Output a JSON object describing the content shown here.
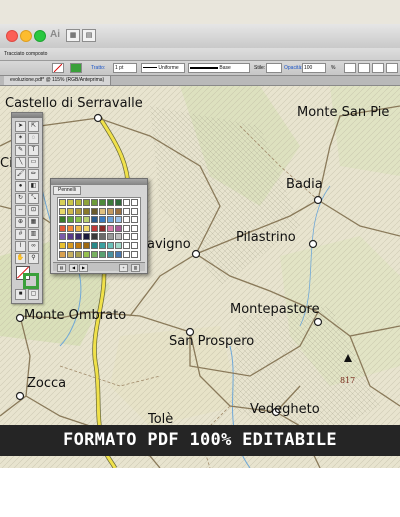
{
  "app": {
    "logo": "Ai"
  },
  "toolbar": {
    "tool_label": "Tracciato composto",
    "stroke_label": "Tratto:",
    "stroke_weight": "1 pt",
    "profile_label": "Uniforme",
    "brush_label": "Base",
    "style_label": "Stile:",
    "opacity_label": "Opacità:",
    "opacity_value": "100",
    "opacity_unit": "%"
  },
  "document": {
    "tab_label": "evoluzione.pdf* @ 115% (RGB/Anteprima)"
  },
  "map": {
    "places": [
      {
        "name": "Castello di Serravalle"
      },
      {
        "name": "Monte San Pie"
      },
      {
        "name": "Badia"
      },
      {
        "name": "Pilastrino"
      },
      {
        "name": "avigno"
      },
      {
        "name": "Montepastore"
      },
      {
        "name": "Monte Ombrato"
      },
      {
        "name": "San Prospero"
      },
      {
        "name": "Zocca"
      },
      {
        "name": "Vedegheto"
      },
      {
        "name": "Tolè"
      },
      {
        "name": "Ci"
      }
    ],
    "elevation_label": "817"
  },
  "swatches": {
    "tab_label": "Pennelli",
    "colors": [
      "#d8d05a",
      "#c9c44a",
      "#b4b53a",
      "#8fa33a",
      "#6c9a3a",
      "#4d8a3a",
      "#3b7a3a",
      "#2f6a3a",
      "#ffffff",
      "#ffffff",
      "#e7d86a",
      "#cfb84a",
      "#b09a3a",
      "#8a7a2a",
      "#6a5a2a",
      "#e0c080",
      "#c49a60",
      "#9a7040",
      "#ffffff",
      "#ffffff",
      "#3a7a2a",
      "#5aa03a",
      "#8ac04a",
      "#b8d070",
      "#2a5a8a",
      "#3a7ac0",
      "#6aa0d8",
      "#9ac0e8",
      "#ffffff",
      "#ffffff",
      "#e05a3a",
      "#f08a3a",
      "#f0b84a",
      "#f0d86a",
      "#c03a3a",
      "#8a2a2a",
      "#d87aa8",
      "#a85a98",
      "#ffffff",
      "#ffffff",
      "#7a5aa8",
      "#5a3a8a",
      "#3a2a6a",
      "#1a1a3a",
      "#3a3a3a",
      "#6a6a6a",
      "#9a9a9a",
      "#c0c0c0",
      "#ffffff",
      "#ffffff",
      "#e8c030",
      "#d89a20",
      "#c07a10",
      "#a06a10",
      "#2a8a8a",
      "#3aa0a0",
      "#6ac0b8",
      "#a0d8c8",
      "#ffffff",
      "#ffffff",
      "#d8a050",
      "#c8b060",
      "#a8a050",
      "#98c050",
      "#78b060",
      "#58a070",
      "#4890a0",
      "#4878b0",
      "#ffffff",
      "#ffffff"
    ]
  },
  "banner": {
    "text": "FORMATO PDF 100% EDITABILE"
  }
}
